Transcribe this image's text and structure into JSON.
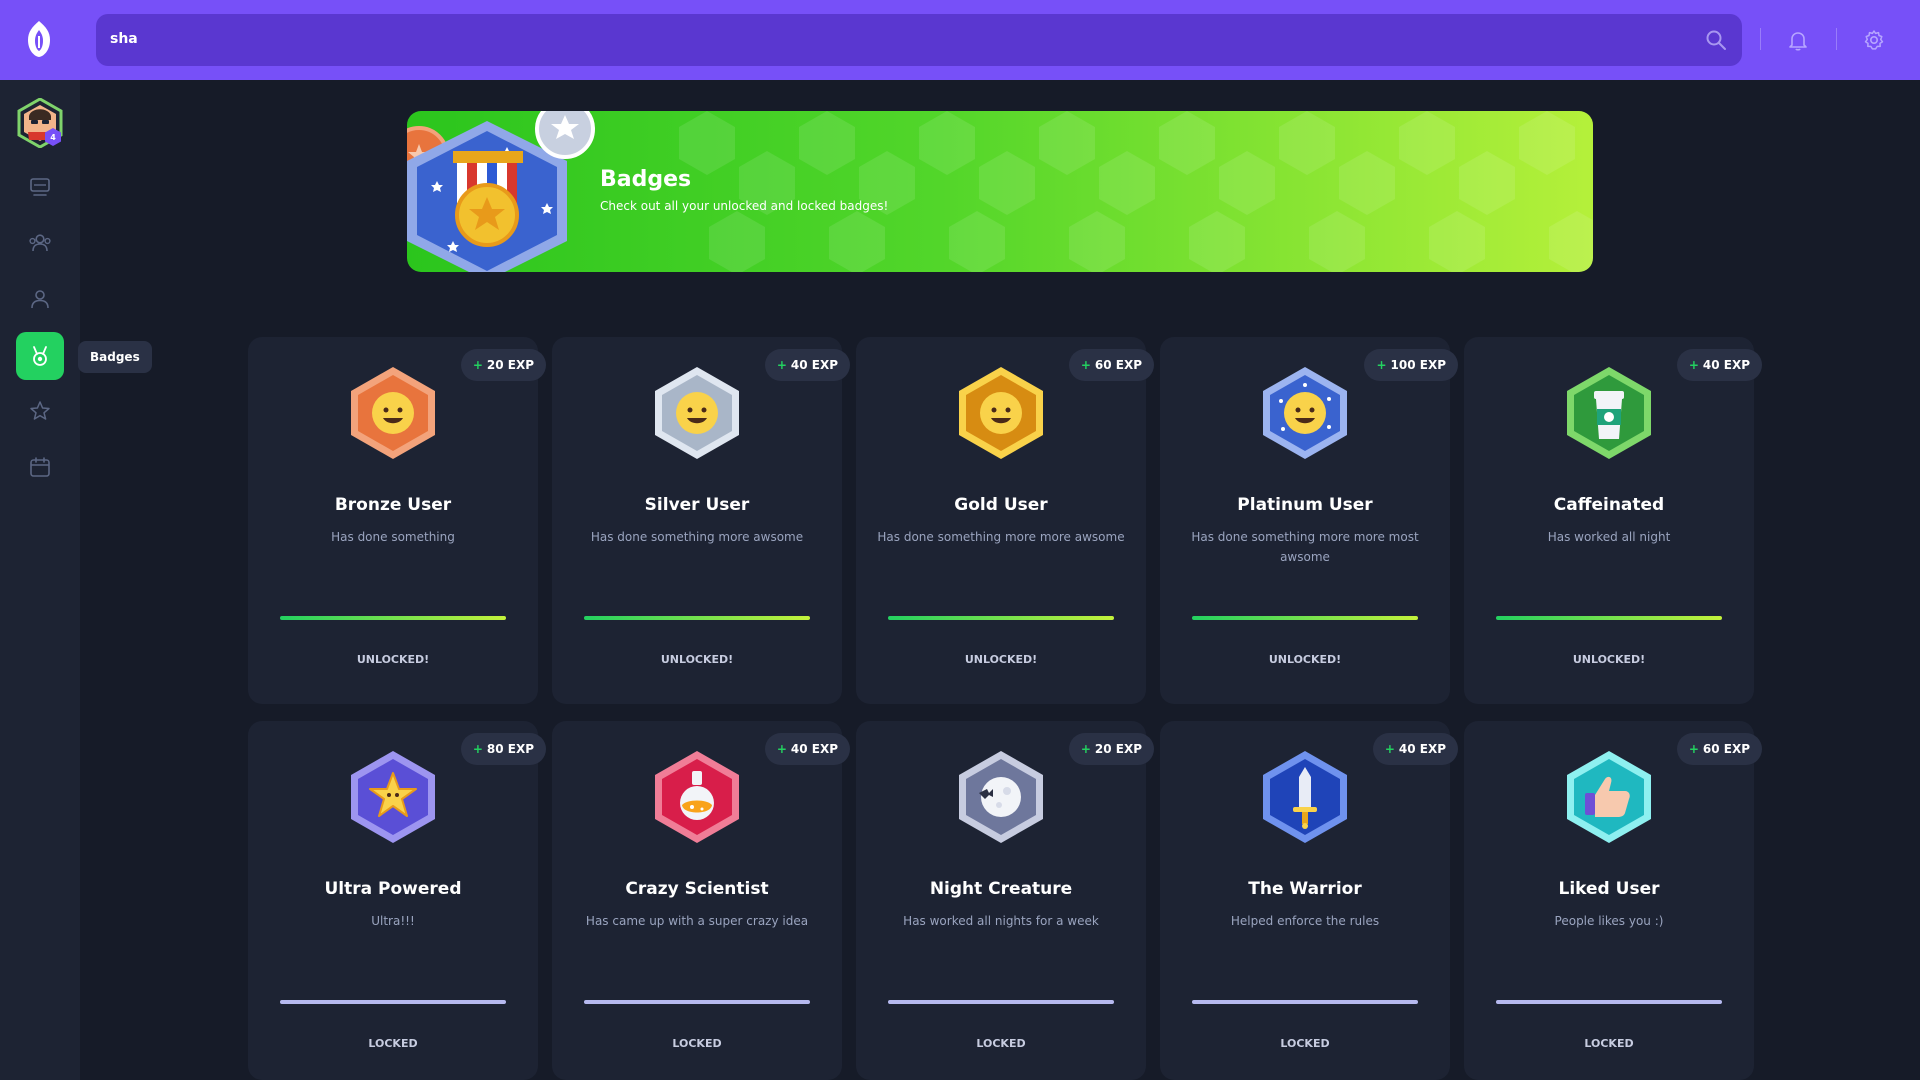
{
  "search": {
    "value": "sha"
  },
  "sidebar": {
    "items": [
      "monitor-icon",
      "users-icon",
      "user-icon",
      "medal-icon",
      "star-icon",
      "calendar-icon"
    ],
    "tooltip": "Badges",
    "avatar_level": "4"
  },
  "banner": {
    "title": "Badges",
    "subtitle": "Check out all your unlocked and locked badges!"
  },
  "badges": [
    {
      "exp": "20 EXP",
      "title": "Bronze User",
      "desc": "Has done something",
      "status": "UNLOCKED!",
      "unlocked": true,
      "color": "#e8743d"
    },
    {
      "exp": "40 EXP",
      "title": "Silver User",
      "desc": "Has done something more awsome",
      "status": "UNLOCKED!",
      "unlocked": true,
      "color": "#a9b6c8"
    },
    {
      "exp": "60 EXP",
      "title": "Gold User",
      "desc": "Has done something more more awsome",
      "status": "UNLOCKED!",
      "unlocked": true,
      "color": "#e8a61a"
    },
    {
      "exp": "100 EXP",
      "title": "Platinum User",
      "desc": "Has done something more more most awsome",
      "status": "UNLOCKED!",
      "unlocked": true,
      "color": "#4a72e0"
    },
    {
      "exp": "40 EXP",
      "title": "Caffeinated",
      "desc": "Has worked all night",
      "status": "UNLOCKED!",
      "unlocked": true,
      "color": "#36b94a"
    },
    {
      "exp": "80 EXP",
      "title": "Ultra Powered",
      "desc": "Ultra!!!",
      "status": "LOCKED",
      "unlocked": false,
      "color": "#5a4fd6"
    },
    {
      "exp": "40 EXP",
      "title": "Crazy Scientist",
      "desc": "Has came up with a super crazy idea",
      "status": "LOCKED",
      "unlocked": false,
      "color": "#e02a55"
    },
    {
      "exp": "20 EXP",
      "title": "Night Creature",
      "desc": "Has worked all nights for a week",
      "status": "LOCKED",
      "unlocked": false,
      "color": "#7a83a8"
    },
    {
      "exp": "40 EXP",
      "title": "The Warrior",
      "desc": "Helped enforce the rules",
      "status": "LOCKED",
      "unlocked": false,
      "color": "#2d5ad4"
    },
    {
      "exp": "60 EXP",
      "title": "Liked User",
      "desc": "People likes you :)",
      "status": "LOCKED",
      "unlocked": false,
      "color": "#2bcfd0"
    }
  ]
}
